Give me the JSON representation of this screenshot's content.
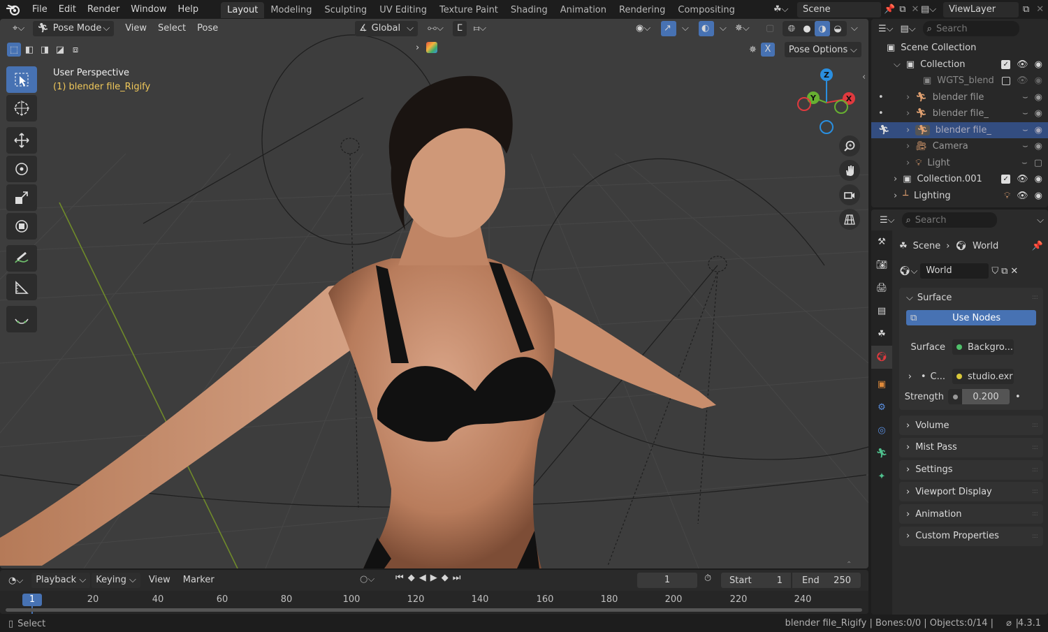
{
  "topbar": {
    "menus": [
      "File",
      "Edit",
      "Render",
      "Window",
      "Help"
    ],
    "workspaces": [
      "Layout",
      "Modeling",
      "Sculpting",
      "UV Editing",
      "Texture Paint",
      "Shading",
      "Animation",
      "Rendering",
      "Compositing"
    ],
    "active_workspace": "Layout",
    "scene": "Scene",
    "view_layer": "ViewLayer"
  },
  "viewport": {
    "mode": "Pose Mode",
    "menus": [
      "View",
      "Select",
      "Pose"
    ],
    "orientation": "Global",
    "overlay_title": "User Perspective",
    "overlay_object": "(1) blender file_Rigify",
    "pose_options": "Pose Options",
    "x_mirror": "X",
    "gizmo_axes": {
      "z": "Z",
      "y": "Y",
      "x": "X"
    }
  },
  "outliner": {
    "search_placeholder": "Search",
    "root": "Scene Collection",
    "items": [
      {
        "label": "Collection",
        "level": 1,
        "type": "collection"
      },
      {
        "label": "WGTS_blend",
        "level": 2,
        "type": "collection"
      },
      {
        "label": "blender file",
        "level": 2,
        "type": "armature"
      },
      {
        "label": "blender file_",
        "level": 2,
        "type": "armature"
      },
      {
        "label": "blender file_",
        "level": 2,
        "type": "armature",
        "selected": true
      },
      {
        "label": "Camera",
        "level": 2,
        "type": "camera"
      },
      {
        "label": "Light",
        "level": 2,
        "type": "light"
      },
      {
        "label": "Collection.001",
        "level": 1,
        "type": "collection"
      },
      {
        "label": "Lighting",
        "level": 1,
        "type": "lighting"
      }
    ]
  },
  "properties": {
    "search_placeholder": "Search",
    "breadcrumb": [
      "Scene",
      "World"
    ],
    "world_name": "World",
    "surface_section": "Surface",
    "use_nodes": "Use Nodes",
    "surface_label": "Surface",
    "surface_value": "Backgro...",
    "color_label": "C...",
    "color_value": "studio.exr",
    "strength_label": "Strength",
    "strength_value": "0.200",
    "panels": [
      "Volume",
      "Mist Pass",
      "Settings",
      "Viewport Display",
      "Animation",
      "Custom Properties"
    ]
  },
  "timeline": {
    "menus": [
      "Playback",
      "Keying",
      "View",
      "Marker"
    ],
    "current_frame": "1",
    "start_label": "Start",
    "start_value": "1",
    "end_label": "End",
    "end_value": "250",
    "ruler": [
      "20",
      "40",
      "60",
      "80",
      "100",
      "120",
      "140",
      "160",
      "180",
      "200",
      "220",
      "240"
    ],
    "cursor": "1"
  },
  "status": {
    "left": "Select",
    "right": "blender file_Rigify | Bones:0/0 | Objects:0/14 |",
    "version": "4.3.1"
  },
  "colors": {
    "accent": "#4772b3",
    "selected_row": "#334d80",
    "axis_x": "#e0393e",
    "axis_y": "#67b031",
    "axis_z": "#2a8fe0"
  }
}
